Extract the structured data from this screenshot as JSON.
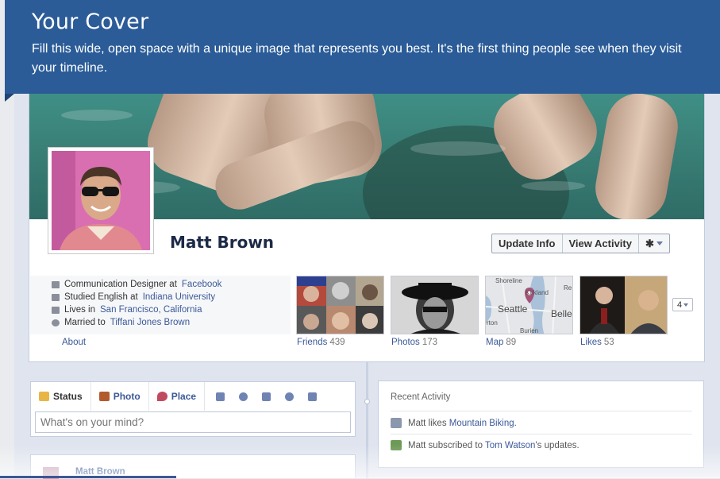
{
  "tooltip": {
    "title": "Your Cover",
    "body": "Fill this wide, open space with a unique image that represents you best. It's the first thing people see when they visit your timeline."
  },
  "profile": {
    "name": "Matt Brown",
    "actions": {
      "update_info": "Update Info",
      "view_activity": "View Activity",
      "gear_icon": "gear-icon"
    }
  },
  "info": {
    "work_prefix": "Communication Designer at",
    "work_link": "Facebook",
    "study_prefix": "Studied English at",
    "study_link": "Indiana University",
    "lives_prefix": "Lives in",
    "lives_link": "San Francisco, California",
    "married_prefix": "Married to",
    "married_link": "Tiffani Jones Brown",
    "about": "About"
  },
  "tiles": {
    "friends": {
      "label": "Friends",
      "count": "439"
    },
    "photos": {
      "label": "Photos",
      "count": "173"
    },
    "map": {
      "label": "Map",
      "count": "89",
      "places": [
        "Shoreline",
        "Kirkland",
        "Seattle",
        "Re",
        "Belle",
        "rton",
        "Burien"
      ]
    },
    "likes": {
      "label": "Likes",
      "count": "53"
    },
    "more": "4"
  },
  "composer": {
    "tabs": [
      "Status",
      "Photo",
      "Place"
    ],
    "placeholder": "What's on your mind?"
  },
  "recent": {
    "title": "Recent Activity",
    "item1_prefix": "Matt likes",
    "item1_link": "Mountain Biking.",
    "item2_prefix": "Matt subscribed to",
    "item2_link": "Tom Watson",
    "item2_suffix": "'s updates."
  },
  "story": {
    "name": "Matt Brown"
  },
  "colors": {
    "tooltip_bg": "#2b5c98",
    "link": "#3b5998",
    "name": "#1c2a47"
  }
}
